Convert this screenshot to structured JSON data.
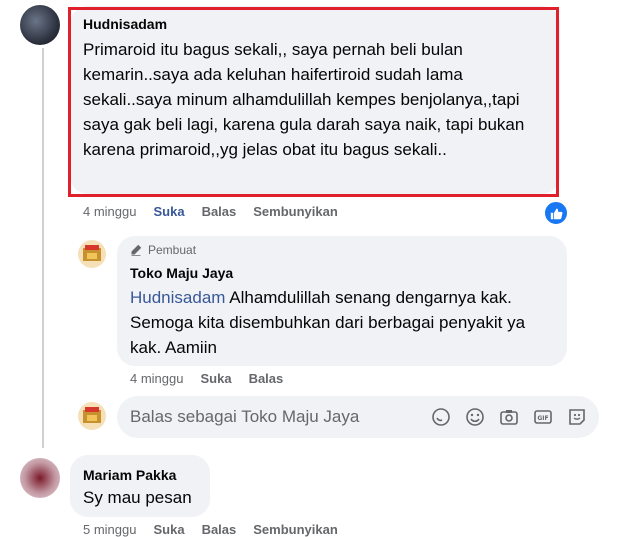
{
  "comments": [
    {
      "author": "Hudnisadam",
      "text": "Primaroid itu bagus sekali,, saya pernah beli bulan kemarin..saya ada keluhan haifertiroid sudah lama sekali..saya minum alhamdulillah kempes benjolanya,,tapi saya gak beli lagi, karena gula darah saya naik, tapi bukan karena primaroid,,yg jelas obat itu bagus sekali..",
      "time": "4 minggu",
      "like": "Suka",
      "reply": "Balas",
      "hide": "Sembunyikan"
    },
    {
      "author": "Mariam Pakka",
      "text": "Sy mau pesan",
      "time": "5 minggu",
      "like": "Suka",
      "reply": "Balas",
      "hide": "Sembunyikan"
    }
  ],
  "reply": {
    "badge": "Pembuat",
    "author": "Toko Maju Jaya",
    "mention": "Hudnisadam",
    "text": "Alhamdulillah senang dengarnya kak. Semoga kita disembuhkan dari berbagai penyakit ya kak. Aamiin",
    "time": "4 minggu",
    "like": "Suka",
    "reply": "Balas"
  },
  "composer": {
    "placeholder": "Balas sebagai Toko Maju Jaya",
    "icons": [
      "sticker-icon",
      "emoji-icon",
      "camera-icon",
      "gif-icon",
      "avatar-sticker-icon"
    ]
  },
  "colors": {
    "highlight": "#e0212b",
    "link": "#385898",
    "like": "#1877f2",
    "bubble": "#f0f2f5"
  }
}
